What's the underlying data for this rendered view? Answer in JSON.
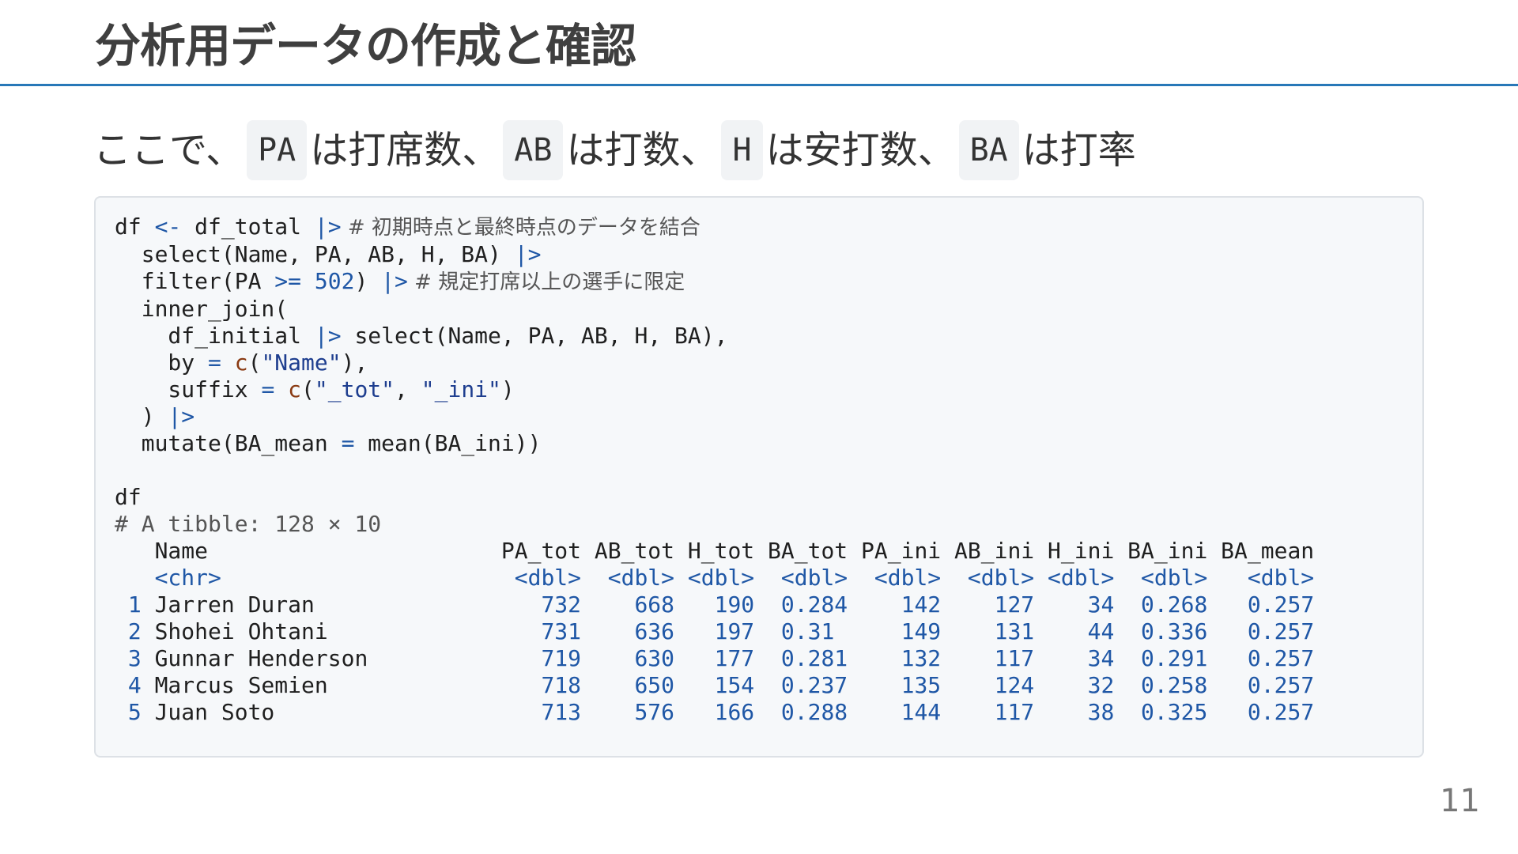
{
  "title": "分析用データの作成と確認",
  "lead": {
    "prefix": "ここで、",
    "items": [
      {
        "code": "PA",
        "text": "は打席数、"
      },
      {
        "code": "AB",
        "text": "は打数、"
      },
      {
        "code": "H",
        "text": "は安打数、"
      },
      {
        "code": "BA",
        "text": "は打率"
      }
    ]
  },
  "code": {
    "l1": {
      "a": "df ",
      "op": "<-",
      "b": " df_total ",
      "pipe": "|>",
      "cmt": " # 初期時点と最終時点のデータを結合"
    },
    "l2": {
      "a": "  select(Name, PA, AB, H, BA) ",
      "pipe": "|>"
    },
    "l3": {
      "a": "  filter(PA ",
      "op": ">=",
      "num": " 502",
      "b": ") ",
      "pipe": "|>",
      "cmt": " # 規定打席以上の選手に限定"
    },
    "l4": {
      "a": "  inner_join("
    },
    "l5": {
      "a": "    df_initial ",
      "pipe": "|>",
      "b": " select(Name, PA, AB, H, BA),"
    },
    "l6": {
      "a": "    by ",
      "op": "=",
      "fn": " c",
      "b": "(",
      "str": "\"Name\"",
      "c": "),"
    },
    "l7": {
      "a": "    suffix ",
      "op": "=",
      "fn": " c",
      "b": "(",
      "str1": "\"_tot\"",
      "c": ", ",
      "str2": "\"_ini\"",
      "d": ")"
    },
    "l8": {
      "a": "  ) ",
      "pipe": "|>"
    },
    "l9": {
      "a": "  mutate(BA_mean ",
      "op": "=",
      "b": " mean(BA_ini))"
    },
    "l10": {
      "a": ""
    },
    "l11": {
      "a": "df"
    }
  },
  "output": {
    "summary": "# A tibble: 128 × 10",
    "header": "   Name                      PA_tot AB_tot H_tot BA_tot PA_ini AB_ini H_ini BA_ini BA_mean",
    "types": "   <chr>                      <dbl>  <dbl> <dbl>  <dbl>  <dbl>  <dbl> <dbl>  <dbl>   <dbl>",
    "rows": [
      {
        "idx": " 1",
        "name": " Jarren Duran            ",
        "vals": "     732    668   190  0.284    142    127    34  0.268   0.257"
      },
      {
        "idx": " 2",
        "name": " Shohei Ohtani           ",
        "vals": "     731    636   197  0.31     149    131    44  0.336   0.257"
      },
      {
        "idx": " 3",
        "name": " Gunnar Henderson        ",
        "vals": "     719    630   177  0.281    132    117    34  0.291   0.257"
      },
      {
        "idx": " 4",
        "name": " Marcus Semien           ",
        "vals": "     718    650   154  0.237    135    124    32  0.258   0.257"
      },
      {
        "idx": " 5",
        "name": " Juan Soto               ",
        "vals": "     713    576   166  0.288    144    117    38  0.325   0.257"
      }
    ]
  },
  "page_number": "11"
}
